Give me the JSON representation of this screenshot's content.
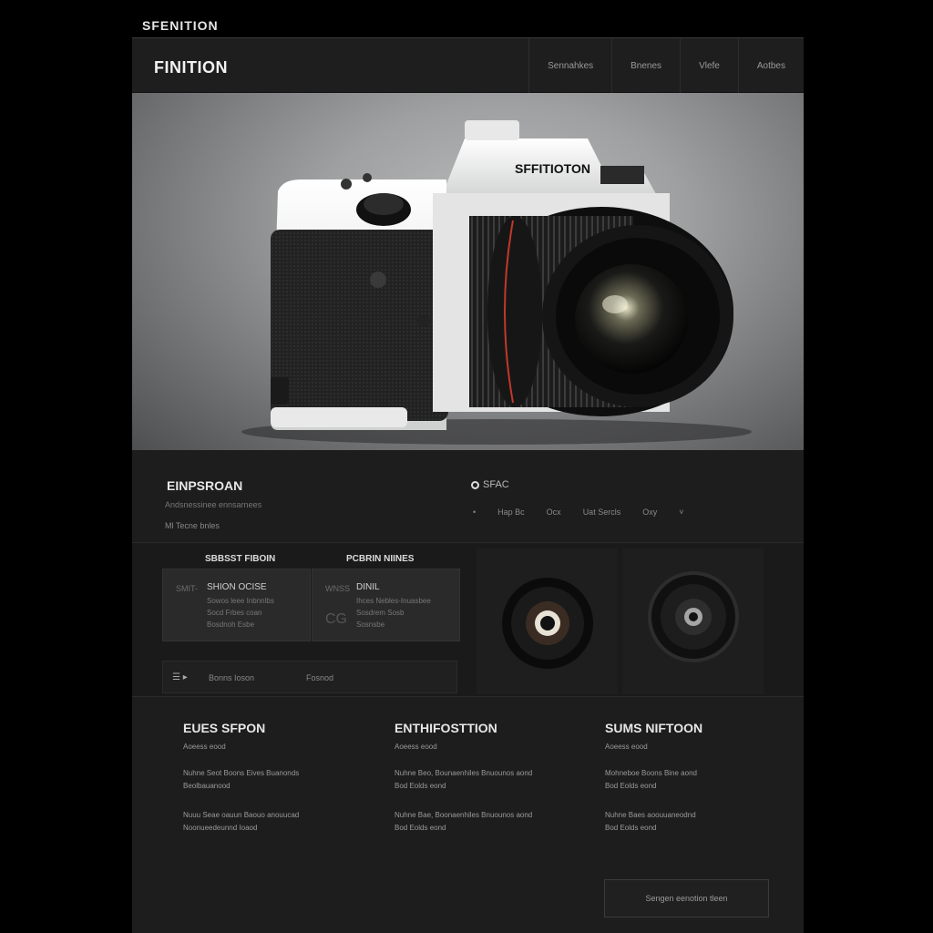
{
  "site_label": "SFENITION",
  "header": {
    "brand": "FINITION",
    "nav": [
      "Sennahkes",
      "Bnenes",
      "Vlefe",
      "Aotbes"
    ]
  },
  "hero": {
    "camera_text": "SFFITIOTON"
  },
  "info": {
    "title": "EINPSROAN",
    "sub1": "Andsnessinee ennsarnees",
    "sub2": "Ml Tecne bnles",
    "spec_label": "SFAC",
    "spec_items": [
      "Hap Bc",
      "Ocx",
      "Uat Sercls",
      "Oxy"
    ],
    "spec_bullet": "•",
    "spec_chevron": "˅"
  },
  "features": {
    "heading_left": "SBBSST FIBOIN",
    "heading_right": "PCBRIN NIINES",
    "card1": {
      "pre": "SMIT-",
      "title": "SHION OCISE",
      "line1": "Sowos leee Inbnnlbs",
      "line2": "Socd Frbes coan",
      "line3": "Bosdnoh Esbe",
      "glyph": ""
    },
    "card2": {
      "pre": "WNSS",
      "title": "DINIL",
      "line1": "Ihces Nebles-Inuasbee",
      "line2": "Sosdrem Sosb",
      "line3": "Sosnsbe",
      "glyph": "CG"
    },
    "bar_icon": "☰ ▸",
    "bar_t1": "Bonns Ioson",
    "bar_t2": "Fosnod"
  },
  "columns": [
    {
      "title": "EUES SFPON",
      "sub": "Aoeess eood",
      "p1a": "Nuhne Seot Boons Eives Buanonds",
      "p1b": "Beolbauanood",
      "p2a": "Nuuu Seae oauun Baouo anouucad",
      "p2b": "Noonueedeunnd Ioaod"
    },
    {
      "title": "ENTHIFOSTTION",
      "sub": "Aoeess eood",
      "p1a": "Nuhne Beo, Bounaenhiles Bnuounos aond",
      "p1b": "Bod Eolds eond",
      "p2a": "Nuhne Bae, Boonaenhiles Bnuounos aond",
      "p2b": "Bod Eolds eond"
    },
    {
      "title": "SUMS NIFTOON",
      "sub": "Aoeess eood",
      "p1a": "Mohneboe Boons Bine aond",
      "p1b": "Bod Eolds eond",
      "p2a": "Nuhne Baes aoouuaneodnd",
      "p2b": "Bod Eolds eond"
    }
  ],
  "cta_label": "Sengen eenotion tleen",
  "colors": {
    "background": "#000000",
    "page": "#1b1b1c",
    "accent_lens_ring": "#c0392b"
  }
}
